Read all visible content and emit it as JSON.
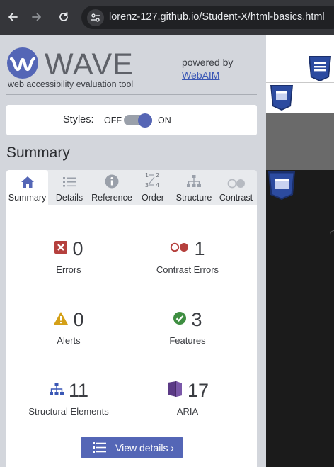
{
  "browser": {
    "url": "lorenz-127.github.io/Student-X/html-basics.html",
    "icons": [
      "back-arrow-icon",
      "forward-arrow-icon",
      "reload-icon",
      "site-settings-icon"
    ]
  },
  "wave": {
    "logo_text": "WAVE",
    "tagline": "web accessibility evaluation tool",
    "powered_by": "powered by",
    "webaim_link": "WebAIM",
    "styles": {
      "label": "Styles:",
      "off": "OFF",
      "on": "ON",
      "state": "on"
    },
    "summary_heading": "Summary",
    "tabs": [
      {
        "label": "Summary",
        "icon": "home-icon",
        "active": true
      },
      {
        "label": "Details",
        "icon": "list-icon",
        "active": false
      },
      {
        "label": "Reference",
        "icon": "info-icon",
        "active": false
      },
      {
        "label": "Order",
        "icon": "order-icon",
        "active": false
      },
      {
        "label": "Structure",
        "icon": "structure-icon",
        "active": false
      },
      {
        "label": "Contrast",
        "icon": "contrast-icon",
        "active": false
      }
    ],
    "stats": [
      {
        "key": "errors",
        "count": "0",
        "label": "Errors",
        "icon": "error-icon",
        "color": "#b5403d"
      },
      {
        "key": "contrast_errors",
        "count": "1",
        "label": "Contrast Errors",
        "icon": "contrast-error-icon",
        "color": "#b5403d"
      },
      {
        "key": "alerts",
        "count": "0",
        "label": "Alerts",
        "icon": "alert-icon",
        "color": "#d4a017"
      },
      {
        "key": "features",
        "count": "3",
        "label": "Features",
        "icon": "feature-check-icon",
        "color": "#3e8e41"
      },
      {
        "key": "structural",
        "count": "11",
        "label": "Structural Elements",
        "icon": "structure-icon",
        "color": "#3a57b5"
      },
      {
        "key": "aria",
        "count": "17",
        "label": "ARIA",
        "icon": "aria-icon",
        "color": "#5b3a86"
      }
    ],
    "view_details": "View details ›",
    "colors": {
      "accent": "#5466b6",
      "sidebar_bg": "#d3d6dc"
    }
  }
}
